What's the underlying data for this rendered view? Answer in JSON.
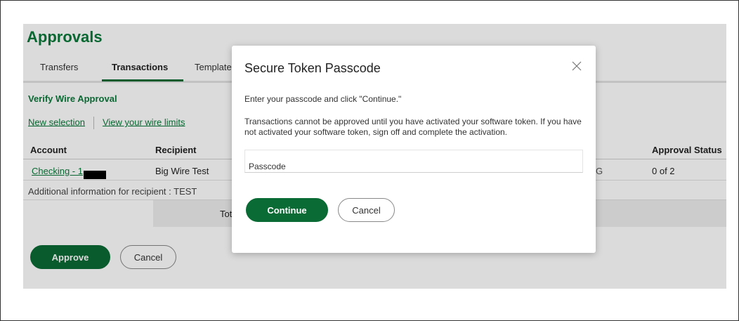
{
  "page": {
    "title": "Approvals",
    "tabs": [
      {
        "label": "Transfers"
      },
      {
        "label": "Transactions"
      },
      {
        "label": "Template"
      }
    ],
    "section_title": "Verify Wire Approval",
    "links": {
      "new_selection": "New selection",
      "view_limits": "View your wire limits"
    },
    "table": {
      "headers": {
        "account": "Account",
        "recipient": "Recipient",
        "approval_status": "Approval Status"
      },
      "row": {
        "account": "Checking - 1",
        "recipient": "Big Wire Test",
        "partial": "G",
        "approval_status": "0 of 2"
      },
      "additional_info": "Additional information for recipient : TEST",
      "total_label": "Tot"
    },
    "buttons": {
      "approve": "Approve",
      "cancel": "Cancel"
    }
  },
  "modal": {
    "title": "Secure Token Passcode",
    "instruction": "Enter your passcode and click \"Continue.\"",
    "warning": "Transactions cannot be approved until you have activated your software token. If you have not activated your software token, sign off and complete the activation.",
    "passcode_placeholder": "Passcode",
    "passcode_value": "",
    "continue_label": "Continue",
    "cancel_label": "Cancel"
  },
  "colors": {
    "brand_green": "#0b7a3b",
    "button_green": "#0b6b35"
  }
}
